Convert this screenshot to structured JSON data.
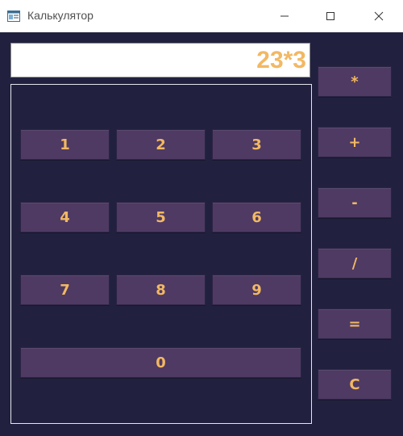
{
  "window": {
    "title": "Калькулятор",
    "minimize_label": "minimize",
    "maximize_label": "maximize",
    "close_label": "close"
  },
  "display": {
    "value": "23*3"
  },
  "keypad": {
    "k1": "1",
    "k2": "2",
    "k3": "3",
    "k4": "4",
    "k5": "5",
    "k6": "6",
    "k7": "7",
    "k8": "8",
    "k9": "9",
    "k0": "0"
  },
  "operators": {
    "multiply": "*",
    "plus": "+",
    "minus": "-",
    "divide": "/",
    "equals": "=",
    "clear": "C"
  },
  "colors": {
    "background": "#21213f",
    "button": "#4e3a63",
    "accent_text": "#f2b863",
    "titlebar": "#ffffff"
  }
}
